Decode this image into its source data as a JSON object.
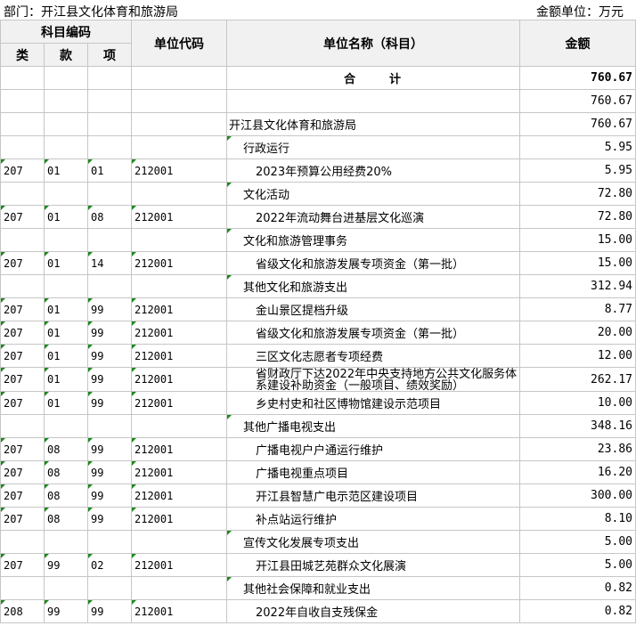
{
  "header": {
    "department": "部门：开江县文化体育和旅游局",
    "unit": "金额单位：万元"
  },
  "table": {
    "head": {
      "subject_code": "科目编码",
      "lei": "类",
      "kuan": "款",
      "xiang": "项",
      "unit_code": "单位代码",
      "unit_name": "单位名称（科目）",
      "amount": "金额"
    },
    "total": {
      "label_a": "合",
      "label_b": "计",
      "amount": "760.67"
    },
    "rows": [
      {
        "lei": "",
        "kuan": "",
        "xiang": "",
        "code": "",
        "name": "",
        "amount": "760.67",
        "level": 1,
        "marks": []
      },
      {
        "lei": "",
        "kuan": "",
        "xiang": "",
        "code": "",
        "name": "开江县文化体育和旅游局",
        "amount": "760.67",
        "level": 1,
        "marks": []
      },
      {
        "lei": "",
        "kuan": "",
        "xiang": "",
        "code": "",
        "name": "行政运行",
        "amount": "5.95",
        "level": 2,
        "marks": [
          "name"
        ]
      },
      {
        "lei": "207",
        "kuan": "01",
        "xiang": "01",
        "code": "212001",
        "name": "2023年预算公用经费20%",
        "amount": "5.95",
        "level": 3,
        "marks": [
          "lei",
          "kuan",
          "xiang",
          "code"
        ]
      },
      {
        "lei": "",
        "kuan": "",
        "xiang": "",
        "code": "",
        "name": "文化活动",
        "amount": "72.80",
        "level": 2,
        "marks": [
          "name"
        ]
      },
      {
        "lei": "207",
        "kuan": "01",
        "xiang": "08",
        "code": "212001",
        "name": "2022年流动舞台进基层文化巡演",
        "amount": "72.80",
        "level": 3,
        "marks": [
          "lei",
          "kuan",
          "xiang",
          "code"
        ]
      },
      {
        "lei": "",
        "kuan": "",
        "xiang": "",
        "code": "",
        "name": "文化和旅游管理事务",
        "amount": "15.00",
        "level": 2,
        "marks": [
          "name"
        ]
      },
      {
        "lei": "207",
        "kuan": "01",
        "xiang": "14",
        "code": "212001",
        "name": "省级文化和旅游发展专项资金（第一批）",
        "amount": "15.00",
        "level": 3,
        "marks": [
          "lei",
          "kuan",
          "xiang",
          "code"
        ]
      },
      {
        "lei": "",
        "kuan": "",
        "xiang": "",
        "code": "",
        "name": "其他文化和旅游支出",
        "amount": "312.94",
        "level": 2,
        "marks": [
          "name"
        ]
      },
      {
        "lei": "207",
        "kuan": "01",
        "xiang": "99",
        "code": "212001",
        "name": "金山景区提档升级",
        "amount": "8.77",
        "level": 3,
        "marks": [
          "lei",
          "kuan",
          "xiang",
          "code"
        ]
      },
      {
        "lei": "207",
        "kuan": "01",
        "xiang": "99",
        "code": "212001",
        "name": "省级文化和旅游发展专项资金（第一批）",
        "amount": "20.00",
        "level": 3,
        "marks": [
          "lei",
          "kuan",
          "xiang",
          "code"
        ]
      },
      {
        "lei": "207",
        "kuan": "01",
        "xiang": "99",
        "code": "212001",
        "name": "三区文化志愿者专项经费",
        "amount": "12.00",
        "level": 3,
        "marks": [
          "lei",
          "kuan",
          "xiang",
          "code"
        ]
      },
      {
        "lei": "207",
        "kuan": "01",
        "xiang": "99",
        "code": "212001",
        "name": "省财政厅下达2022年中央支持地方公共文化服务体系建设补助资金（一般项目、绩效奖励）",
        "amount": "262.17",
        "level": 3,
        "marks": [
          "lei",
          "kuan",
          "xiang",
          "code"
        ],
        "wrap": true
      },
      {
        "lei": "207",
        "kuan": "01",
        "xiang": "99",
        "code": "212001",
        "name": "乡史村史和社区博物馆建设示范项目",
        "amount": "10.00",
        "level": 3,
        "marks": [
          "lei",
          "kuan",
          "xiang",
          "code"
        ]
      },
      {
        "lei": "",
        "kuan": "",
        "xiang": "",
        "code": "",
        "name": "其他广播电视支出",
        "amount": "348.16",
        "level": 2,
        "marks": [
          "name"
        ]
      },
      {
        "lei": "207",
        "kuan": "08",
        "xiang": "99",
        "code": "212001",
        "name": "广播电视户户通运行维护",
        "amount": "23.86",
        "level": 3,
        "marks": [
          "lei",
          "kuan",
          "xiang",
          "code"
        ]
      },
      {
        "lei": "207",
        "kuan": "08",
        "xiang": "99",
        "code": "212001",
        "name": "广播电视重点项目",
        "amount": "16.20",
        "level": 3,
        "marks": [
          "lei",
          "kuan",
          "xiang",
          "code"
        ]
      },
      {
        "lei": "207",
        "kuan": "08",
        "xiang": "99",
        "code": "212001",
        "name": "开江县智慧广电示范区建设项目",
        "amount": "300.00",
        "level": 3,
        "marks": [
          "lei",
          "kuan",
          "xiang",
          "code"
        ]
      },
      {
        "lei": "207",
        "kuan": "08",
        "xiang": "99",
        "code": "212001",
        "name": "补点站运行维护",
        "amount": "8.10",
        "level": 3,
        "marks": [
          "lei",
          "kuan",
          "xiang",
          "code"
        ]
      },
      {
        "lei": "",
        "kuan": "",
        "xiang": "",
        "code": "",
        "name": "宣传文化发展专项支出",
        "amount": "5.00",
        "level": 2,
        "marks": [
          "name"
        ]
      },
      {
        "lei": "207",
        "kuan": "99",
        "xiang": "02",
        "code": "212001",
        "name": "开江县田城艺苑群众文化展演",
        "amount": "5.00",
        "level": 3,
        "marks": [
          "lei",
          "kuan",
          "xiang",
          "code"
        ]
      },
      {
        "lei": "",
        "kuan": "",
        "xiang": "",
        "code": "",
        "name": "其他社会保障和就业支出",
        "amount": "0.82",
        "level": 2,
        "marks": [
          "name"
        ]
      },
      {
        "lei": "208",
        "kuan": "99",
        "xiang": "99",
        "code": "212001",
        "name": "2022年自收自支残保金",
        "amount": "0.82",
        "level": 3,
        "marks": [
          "lei",
          "kuan",
          "xiang",
          "code"
        ]
      }
    ]
  }
}
